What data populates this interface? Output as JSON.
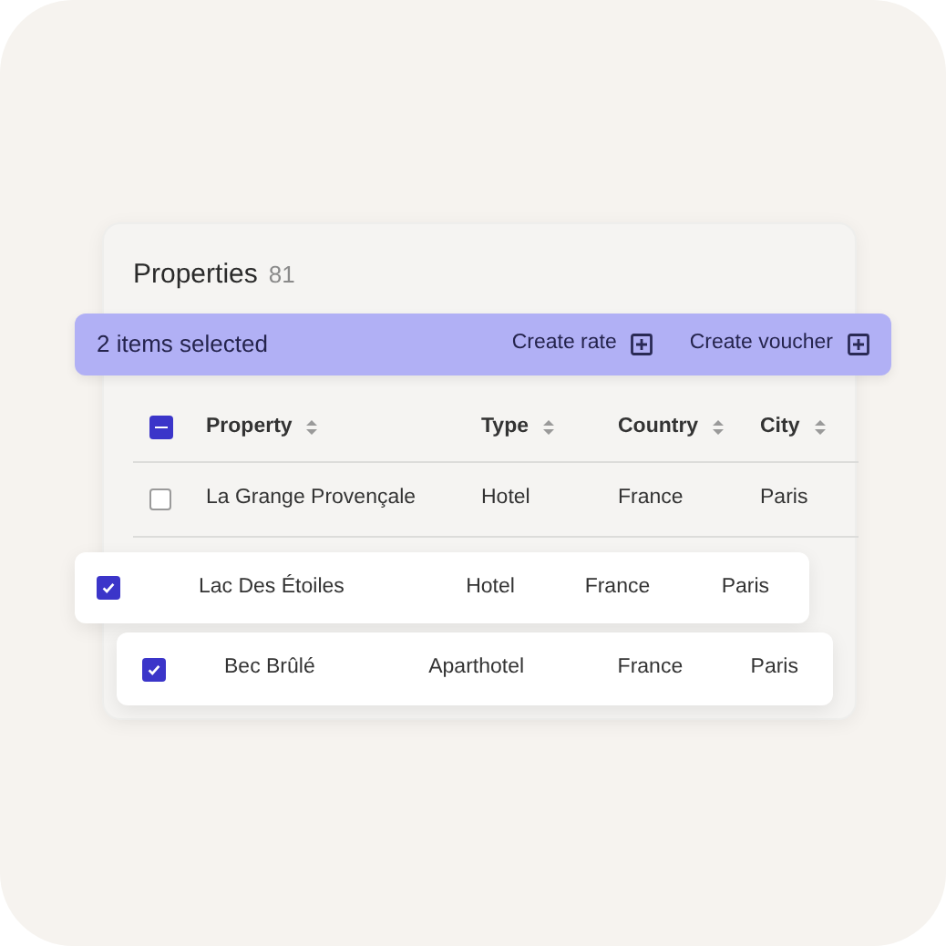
{
  "title": "Properties",
  "count": "81",
  "selection_bar": {
    "label": "2 items selected",
    "actions": [
      "Create rate",
      "Create voucher"
    ]
  },
  "table": {
    "header_checkbox": {
      "checked": true,
      "indeterminate": true
    },
    "columns": [
      "Property",
      "Type",
      "Country",
      "City"
    ],
    "rows": [
      {
        "kind": "row",
        "selected": false,
        "cells": [
          "La Grange Provençale",
          "Hotel",
          "France",
          "Paris"
        ]
      },
      {
        "kind": "lifted",
        "selected": true,
        "cells": [
          "Lac Des Étoiles",
          "Hotel",
          "France",
          "Paris"
        ]
      },
      {
        "kind": "lifted",
        "selected": true,
        "cells": [
          "Bec Brûlé",
          "Aparthotel",
          "France",
          "Paris"
        ]
      }
    ]
  }
}
